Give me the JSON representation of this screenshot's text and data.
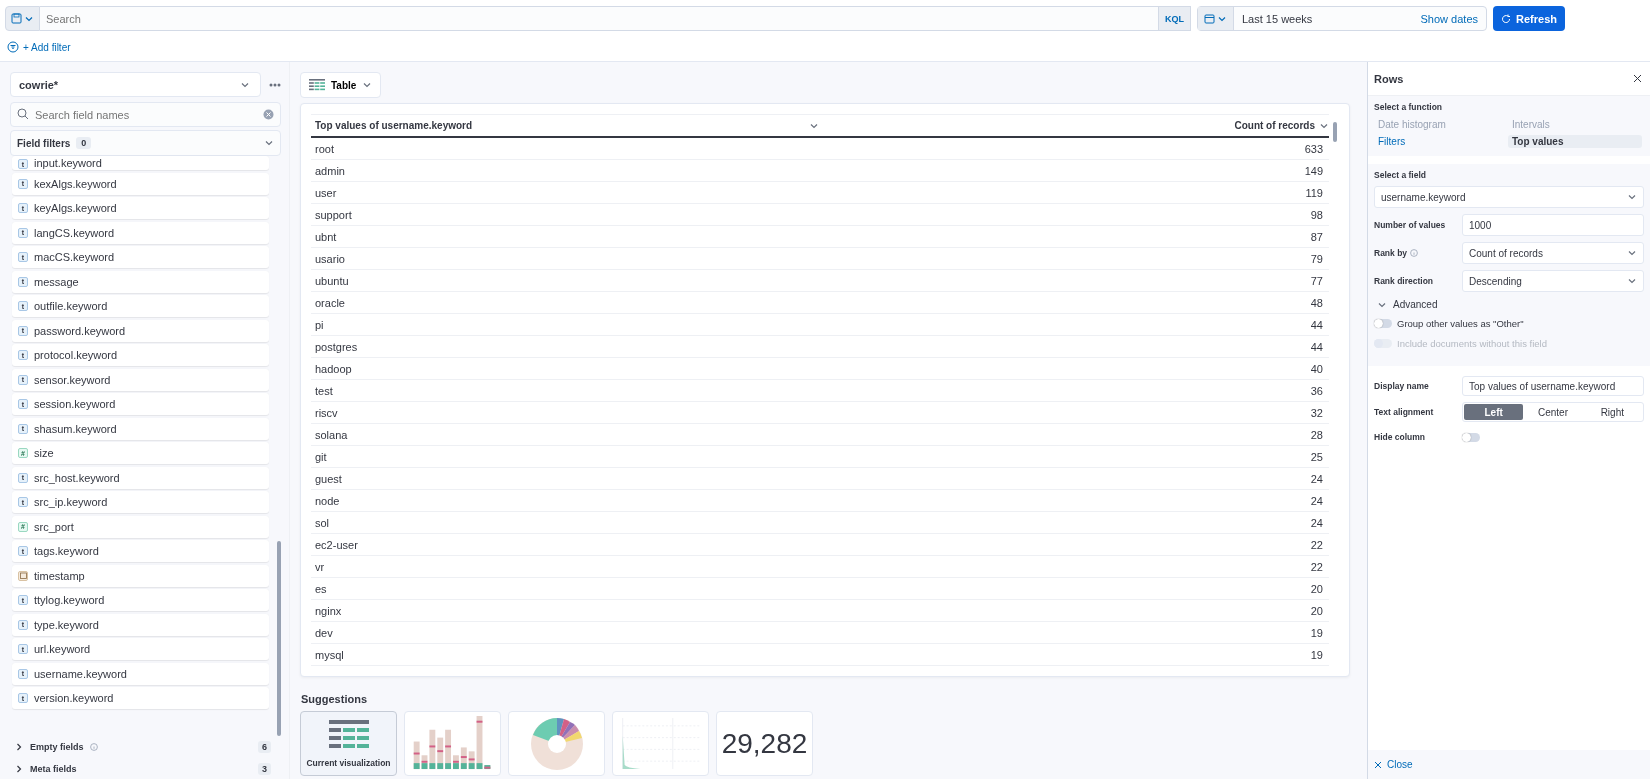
{
  "query_bar": {
    "placeholder": "Search",
    "language": "KQL"
  },
  "date_picker": {
    "range": "Last 15 weeks",
    "show_dates": "Show dates"
  },
  "refresh": "Refresh",
  "add_filter": "+ Add filter",
  "sidebar": {
    "data_view": "cowrie*",
    "search_placeholder": "Search field names",
    "field_filters": {
      "label": "Field filters",
      "count": "0"
    },
    "fields": [
      {
        "name": "input.keyword",
        "kind": "string",
        "badge": "t"
      },
      {
        "name": "kexAlgs.keyword",
        "kind": "string",
        "badge": "t"
      },
      {
        "name": "keyAlgs.keyword",
        "kind": "string",
        "badge": "t"
      },
      {
        "name": "langCS.keyword",
        "kind": "string",
        "badge": "t"
      },
      {
        "name": "macCS.keyword",
        "kind": "string",
        "badge": "t"
      },
      {
        "name": "message",
        "kind": "string",
        "badge": "t"
      },
      {
        "name": "outfile.keyword",
        "kind": "string",
        "badge": "t"
      },
      {
        "name": "password.keyword",
        "kind": "string",
        "badge": "t"
      },
      {
        "name": "protocol.keyword",
        "kind": "string",
        "badge": "t"
      },
      {
        "name": "sensor.keyword",
        "kind": "string",
        "badge": "t"
      },
      {
        "name": "session.keyword",
        "kind": "string",
        "badge": "t"
      },
      {
        "name": "shasum.keyword",
        "kind": "string",
        "badge": "t"
      },
      {
        "name": "size",
        "kind": "number",
        "badge": "#"
      },
      {
        "name": "src_host.keyword",
        "kind": "string",
        "badge": "t"
      },
      {
        "name": "src_ip.keyword",
        "kind": "string",
        "badge": "t"
      },
      {
        "name": "src_port",
        "kind": "number",
        "badge": "#"
      },
      {
        "name": "tags.keyword",
        "kind": "string",
        "badge": "t"
      },
      {
        "name": "timestamp",
        "kind": "date"
      },
      {
        "name": "ttylog.keyword",
        "kind": "string",
        "badge": "t"
      },
      {
        "name": "type.keyword",
        "kind": "string",
        "badge": "t"
      },
      {
        "name": "url.keyword",
        "kind": "string",
        "badge": "t"
      },
      {
        "name": "username.keyword",
        "kind": "string",
        "badge": "t"
      },
      {
        "name": "version.keyword",
        "kind": "string",
        "badge": "t"
      }
    ],
    "groups": [
      {
        "label": "Empty fields",
        "count": "6",
        "info": true,
        "expanded": false
      },
      {
        "label": "Meta fields",
        "count": "3",
        "info": false,
        "expanded": false
      }
    ]
  },
  "visualization": {
    "type": "Table"
  },
  "table": {
    "columns": [
      {
        "label": "Top values of username.keyword"
      },
      {
        "label": "Count of records"
      }
    ],
    "rows": [
      [
        "root",
        "633"
      ],
      [
        "admin",
        "149"
      ],
      [
        "user",
        "119"
      ],
      [
        "support",
        "98"
      ],
      [
        "ubnt",
        "87"
      ],
      [
        "usario",
        "79"
      ],
      [
        "ubuntu",
        "77"
      ],
      [
        "oracle",
        "48"
      ],
      [
        "pi",
        "44"
      ],
      [
        "postgres",
        "44"
      ],
      [
        "hadoop",
        "40"
      ],
      [
        "test",
        "36"
      ],
      [
        "riscv",
        "32"
      ],
      [
        "solana",
        "28"
      ],
      [
        "git",
        "25"
      ],
      [
        "guest",
        "24"
      ],
      [
        "node",
        "24"
      ],
      [
        "sol",
        "24"
      ],
      [
        "ec2-user",
        "22"
      ],
      [
        "vr",
        "22"
      ],
      [
        "es",
        "20"
      ],
      [
        "nginx",
        "20"
      ],
      [
        "dev",
        "19"
      ],
      [
        "mysql",
        "19"
      ]
    ]
  },
  "suggestions": {
    "title": "Suggestions",
    "items": [
      {
        "kind": "table",
        "label": "Current visualization",
        "selected": true
      },
      {
        "kind": "bar",
        "selected": false
      },
      {
        "kind": "pie",
        "selected": false
      },
      {
        "kind": "line",
        "selected": false
      },
      {
        "kind": "metric",
        "value": "29,282",
        "selected": false
      }
    ]
  },
  "panel": {
    "title": "Rows",
    "function": {
      "label": "Select a function",
      "options": [
        {
          "label": "Date histogram",
          "compatible": false,
          "selected": false
        },
        {
          "label": "Intervals",
          "compatible": false,
          "selected": false
        },
        {
          "label": "Filters",
          "compatible": true,
          "selected": false
        },
        {
          "label": "Top values",
          "compatible": true,
          "selected": true
        }
      ]
    },
    "field": {
      "label": "Select a field",
      "value": "username.keyword"
    },
    "settings": [
      {
        "kind": "input",
        "label": "Number of values",
        "value": "1000",
        "info": false
      },
      {
        "kind": "select",
        "label": "Rank by",
        "value": "Count of records",
        "info": true
      },
      {
        "kind": "select",
        "label": "Rank direction",
        "value": "Descending",
        "info": false
      }
    ],
    "advanced": {
      "label": "Advanced",
      "expanded": true,
      "toggles": [
        {
          "label": "Group other values as \"Other\"",
          "on": false,
          "disabled": false
        },
        {
          "label": "Include documents without this field",
          "on": false,
          "disabled": true
        }
      ]
    },
    "display_name": {
      "label": "Display name",
      "value": "Top values of username.keyword"
    },
    "text_alignment": {
      "label": "Text alignment",
      "options": [
        {
          "label": "Left",
          "selected": true
        },
        {
          "label": "Center",
          "selected": false
        },
        {
          "label": "Right",
          "selected": false
        }
      ]
    },
    "hide_column": {
      "label": "Hide column",
      "on": false
    },
    "close": "Close"
  }
}
